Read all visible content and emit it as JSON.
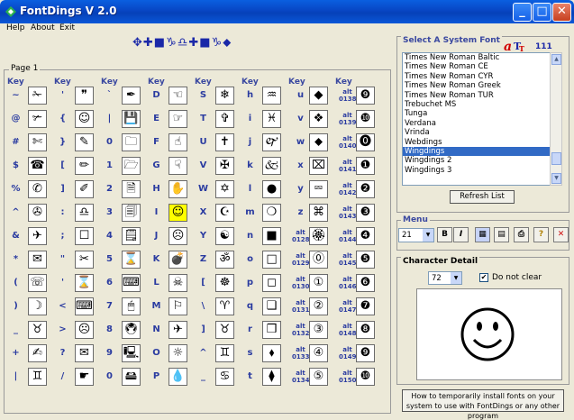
{
  "window": {
    "title": "FontDings V 2.0",
    "minimize": "_",
    "maximize": "□",
    "close": "✕"
  },
  "menu": {
    "help": "Help",
    "about": "About",
    "exit": "Exit"
  },
  "toolbar_symbols": "✥✚■♑♎✚■♑⬥",
  "page": {
    "label": "Page 1",
    "key_header": "Key",
    "columns": [
      {
        "keys": [
          "~",
          "@",
          "#",
          "$",
          "%",
          "^",
          "&",
          "*",
          "(",
          ")",
          "_",
          "+",
          "|"
        ],
        "glyphs": [
          "✁",
          "✃",
          "✄",
          "☎",
          "✆",
          "✇",
          "✈",
          "✉",
          "☏",
          "☽",
          "♉",
          "✍",
          "♊"
        ]
      },
      {
        "keys": [
          "'",
          "{",
          "}",
          "[",
          "]",
          ":",
          ";",
          "\"",
          "'",
          "<",
          ">",
          "?",
          "/"
        ],
        "glyphs": [
          "❞",
          "☺",
          "✎",
          "✏",
          "✐",
          "♎",
          "☐",
          "✂",
          "⌛",
          "⌨",
          "☹",
          "✉",
          "☛"
        ]
      },
      {
        "keys": [
          "`",
          "|",
          "0",
          "1",
          "2",
          "3",
          "4",
          "5",
          "6",
          "7",
          "8",
          "9",
          "0"
        ],
        "glyphs": [
          "✒",
          "💾",
          "🗀",
          "🗁",
          "🗎",
          "🗐",
          "🗒",
          "⌛",
          "⌨",
          "🖱",
          "🖲",
          "🖳",
          "🖴"
        ]
      },
      {
        "keys": [
          "D",
          "E",
          "F",
          "G",
          "H",
          "I",
          "J",
          "K",
          "L",
          "M",
          "N",
          "O",
          "P"
        ],
        "glyphs": [
          "☜",
          "☞",
          "☝",
          "☟",
          "✋",
          "☺",
          "☹",
          "💣",
          "☠",
          "⚐",
          "✈",
          "☼",
          "💧"
        ]
      },
      {
        "keys": [
          "S",
          "T",
          "U",
          "V",
          "W",
          "X",
          "Y",
          "Z",
          "[",
          "\\",
          "]",
          "^",
          "_"
        ],
        "glyphs": [
          "❄",
          "✞",
          "✝",
          "✠",
          "✡",
          "☪",
          "☯",
          "ॐ",
          "☸",
          "♈",
          "♉",
          "♊",
          "♋"
        ]
      },
      {
        "keys": [
          "h",
          "i",
          "j",
          "k",
          "l",
          "m",
          "n",
          "o",
          "p",
          "q",
          "r",
          "s",
          "t"
        ],
        "glyphs": [
          "♒",
          "♓",
          "🙰",
          "🙵",
          "●",
          "❍",
          "■",
          "□",
          "◻",
          "❑",
          "❒",
          "⬧",
          "⧫"
        ]
      },
      {
        "keys": [
          "u",
          "v",
          "w",
          "x",
          "y",
          "z",
          "alt 0128",
          "alt 0129",
          "alt 0130",
          "alt 0131",
          "alt 0132",
          "alt 0133",
          "alt 0134"
        ],
        "glyphs": [
          "◆",
          "❖",
          "⬥",
          "⌧",
          "⮹",
          "⌘",
          "🏵",
          "⓪",
          "①",
          "②",
          "③",
          "④",
          "⑤"
        ]
      },
      {
        "keys": [
          "alt 0138",
          "alt 0139",
          "alt 0140",
          "alt 0141",
          "alt 0142",
          "alt 0143",
          "alt 0144",
          "alt 0145",
          "alt 0146",
          "alt 0147",
          "alt 0148",
          "alt 0149",
          "alt 0150"
        ],
        "glyphs": [
          "❾",
          "❿",
          "⓿",
          "❶",
          "❷",
          "❸",
          "❹",
          "❺",
          "❻",
          "❼",
          "❽",
          "❾",
          "❿"
        ]
      }
    ]
  },
  "font_panel": {
    "title": "Select A System Font",
    "count": "111",
    "fonts": [
      "Times New Roman Baltic",
      "Times New Roman CE",
      "Times New Roman CYR",
      "Times New Roman Greek",
      "Times New Roman TUR",
      "Trebuchet MS",
      "Tunga",
      "Verdana",
      "Vrinda",
      "Webdings",
      "Wingdings",
      "Wingdings 2",
      "Wingdings 3"
    ],
    "selected_font": "Wingdings",
    "refresh": "Refresh List"
  },
  "menu_panel": {
    "title": "Menu",
    "size": "21",
    "bold": "B",
    "italic": "I"
  },
  "char_panel": {
    "title": "Character Detail",
    "size": "72",
    "no_clear": "Do not clear",
    "preview_glyph": "☺"
  },
  "help_button": "How to temporarily install fonts on your system to use with FontDings or any other program",
  "colors": {
    "accent": "#316ac5",
    "key_text": "#2a3ba0",
    "selected_cell": "#ffff00"
  }
}
